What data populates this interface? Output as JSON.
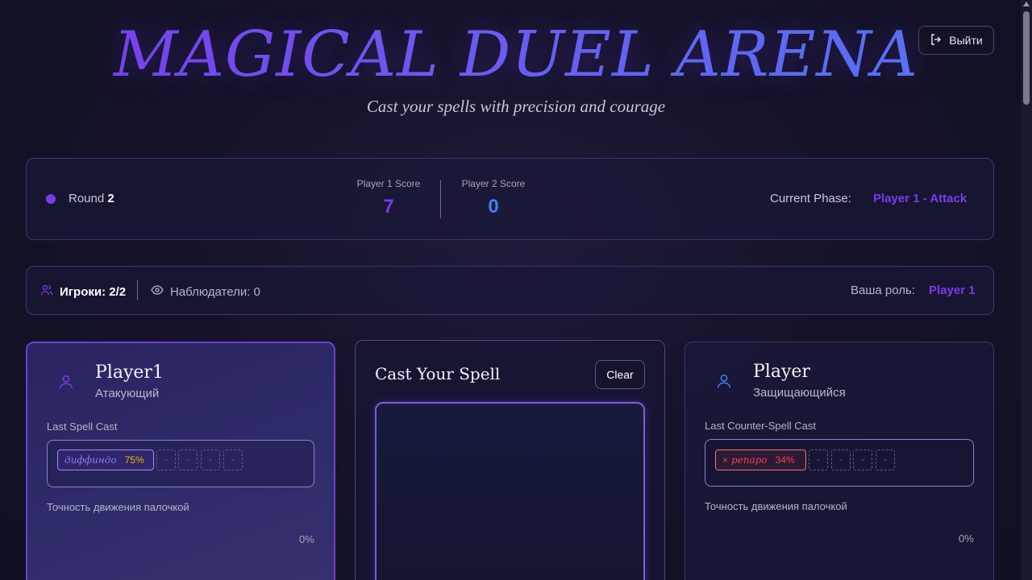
{
  "header": {
    "title": "MAGICAL DUEL ARENA",
    "subtitle": "Cast your spells with precision and courage",
    "logout_label": "Выйти"
  },
  "score_panel": {
    "round_label": "Round",
    "round_value": "2",
    "player1_score_label": "Player 1 Score",
    "player1_score": "7",
    "player2_score_label": "Player 2 Score",
    "player2_score": "0",
    "phase_label": "Current Phase:",
    "phase_value": "Player 1 - Attack"
  },
  "players_panel": {
    "players_label": "Игроки: 2/2",
    "viewers_label": "Наблюдатели: 0",
    "role_label": "Ваша роль:",
    "role_value": "Player 1"
  },
  "attacker": {
    "name": "Player1",
    "role": "Атакующий",
    "last_spell_label": "Last Spell Cast",
    "spell_name": "диффиндо",
    "spell_accuracy": "75%",
    "slots": [
      "-",
      "-",
      "-",
      "-"
    ],
    "wand_accuracy_label": "Точность движения палочкой",
    "wand_accuracy": "0%"
  },
  "spell_canvas": {
    "title": "Cast Your Spell",
    "clear_label": "Clear"
  },
  "defender": {
    "name": "Player",
    "role": "Защищающийся",
    "last_spell_label": "Last Counter-Spell Cast",
    "spell_mark": "×",
    "spell_name": "репаро",
    "spell_accuracy": "34%",
    "slots": [
      "-",
      "-",
      "-",
      "-"
    ],
    "wand_accuracy_label": "Точность движения палочкой",
    "wand_accuracy": "0%"
  },
  "colors": {
    "accent_purple": "#7c3aed",
    "accent_blue": "#3b82f6",
    "success_yellow": "#eab308",
    "error_red": "#ef4444"
  }
}
